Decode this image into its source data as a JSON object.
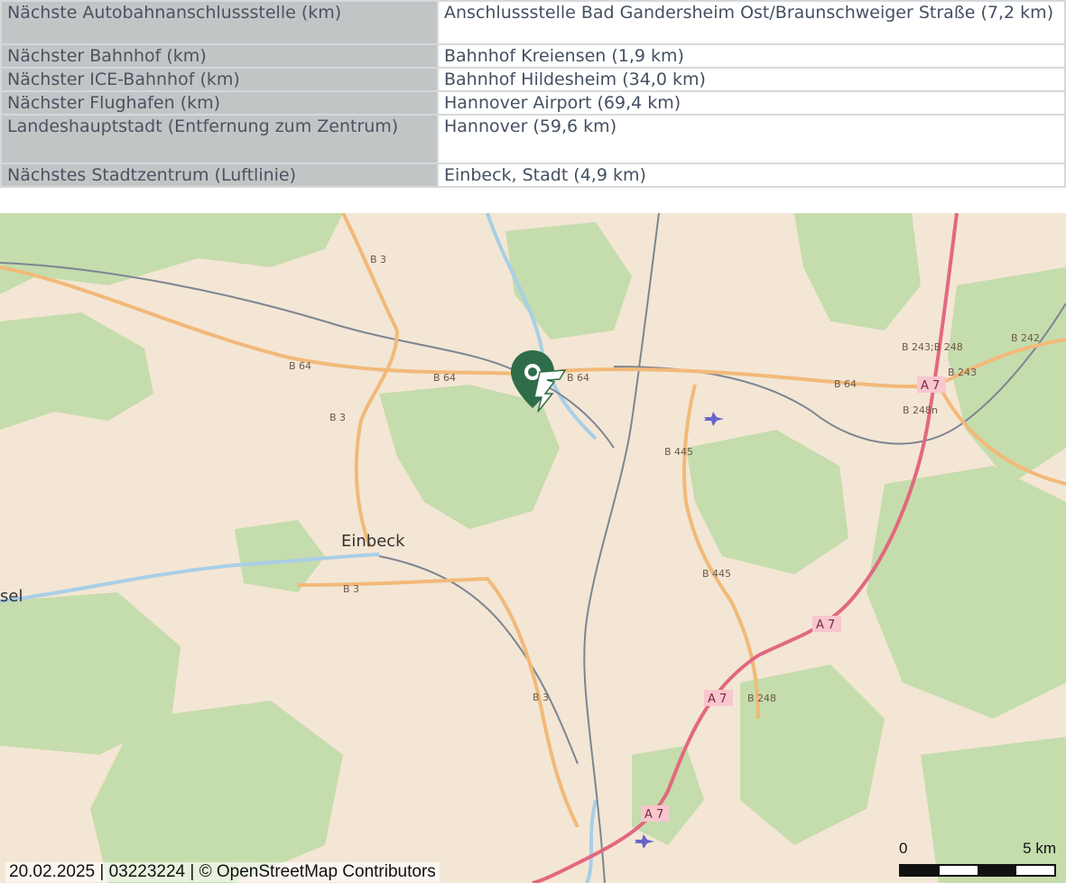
{
  "table": {
    "rows": [
      {
        "label": "Nächste Autobahnanschlussstelle (km)",
        "value": "Anschlussstelle Bad Gandersheim Ost/Braunschweiger Straße (7,2 km)"
      },
      {
        "label": "Nächster Bahnhof (km)",
        "value": "Bahnhof Kreiensen (1,9 km)"
      },
      {
        "label": "Nächster ICE-Bahnhof (km)",
        "value": "Bahnhof Hildesheim (34,0 km)"
      },
      {
        "label": "Nächster Flughafen (km)",
        "value": "Hannover Airport (69,4 km)"
      },
      {
        "label": "Landeshauptstadt (Entfernung zum Zentrum)",
        "value": "Hannover (59,6 km)"
      },
      {
        "label": "Nächstes Stadtzentrum (Luftlinie)",
        "value": "Einbeck, Stadt (4,9 km)"
      }
    ]
  },
  "map": {
    "town_labels": [
      "Einbeck",
      "sel"
    ],
    "road_labels": [
      "B 3",
      "B 64",
      "B 445",
      "B 243;B 248",
      "B 243",
      "B 242",
      "B 248n",
      "B 248"
    ],
    "autobahn_label": "A 7",
    "marker_icon": "location-pin-icon",
    "airport_icon": "airplane-icon",
    "colors": {
      "autobahn": "#e2687f",
      "bundesstrasse": "#f2b979",
      "forest": "#c5dcac",
      "water": "#a8cfe6",
      "railway": "#7d8591"
    }
  },
  "footer": {
    "text": "20.02.2025 | 03223224 | © OpenStreetMap Contributors"
  },
  "scale": {
    "start": "0",
    "end": "5 km"
  }
}
